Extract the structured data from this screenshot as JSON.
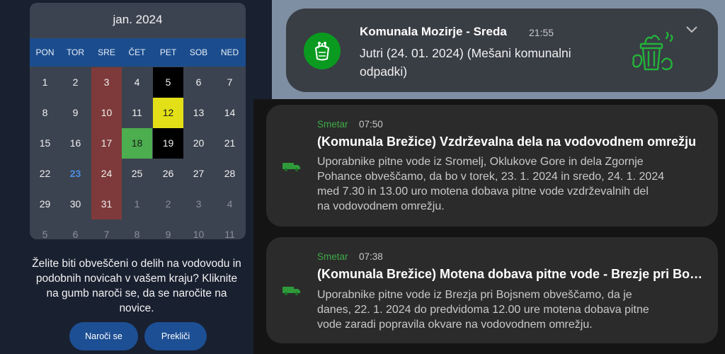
{
  "calendar": {
    "month_label": "jan. 2024",
    "weekdays": [
      "PON",
      "TOR",
      "SRE",
      "ČET",
      "PET",
      "SOB",
      "NED"
    ],
    "weeks": [
      [
        "1",
        "2",
        "3",
        "4",
        "5",
        "6",
        "7"
      ],
      [
        "8",
        "9",
        "10",
        "11",
        "12",
        "13",
        "14"
      ],
      [
        "15",
        "16",
        "17",
        "18",
        "19",
        "20",
        "21"
      ],
      [
        "22",
        "23",
        "24",
        "25",
        "26",
        "27",
        "28"
      ],
      [
        "29",
        "30",
        "31",
        "1",
        "2",
        "3",
        "4"
      ],
      [
        "5",
        "6",
        "7",
        "8",
        "9",
        "10",
        "11"
      ]
    ],
    "today": "23",
    "highlight_colors": {
      "wednesday": "#7e3a3a",
      "black": "#000000",
      "yellow": "#e3e017",
      "green": "#4cae4f"
    }
  },
  "prompt": {
    "lines": [
      "Želite biti obveščeni o delih na vodovodu in",
      "podobnih novicah v vašem kraju? Kliknite",
      "na gumb naroči se, da se naročite na",
      "novice."
    ]
  },
  "buttons": {
    "subscribe": "Naroči se",
    "cancel": "Prekliči"
  },
  "notification_top": {
    "title": "Komunala Mozirje - Sreda",
    "time": "21:55",
    "body_lines": [
      "Jutri (24. 01. 2024) (Mešani komunalni",
      "odpadki)"
    ],
    "icon": "garbage-bag-icon",
    "thumb_icon": "waste-bin-icon",
    "expand_icon": "chevron-down-icon",
    "accent": "#0a9a20"
  },
  "notifications": [
    {
      "app": "Smetar",
      "time": "07:50",
      "title": "(Komunala Brežice) Vzdrževalna dela na vodovodnem omrežju",
      "body_lines": [
        "Uporabnike pitne vode iz Sromelj, Oklukove Gore in dela Zgornje",
        "Pohance obveščamo, da bo v torek, 23. 1. 2024 in sredo, 24. 1. 2024",
        "med 7.30 in 13.00 uro motena dobava pitne vode  vzdrževalnih del",
        "na vodovodnem omrežju."
      ],
      "icon": "garbage-truck-icon"
    },
    {
      "app": "Smetar",
      "time": "07:38",
      "title": "(Komunala Brežice) Motena dobava pitne vode - Brezje pri Bojsnem",
      "body_lines": [
        "Uporabnike pitne vode iz Brezja pri Bojsnem obveščamo, da je",
        "danes, 22. 1. 2024 do predvidoma 12.00 ure motena dobava pitne",
        "vode zaradi popravila okvare na vodovodnem omrežju."
      ],
      "icon": "garbage-truck-icon"
    }
  ]
}
